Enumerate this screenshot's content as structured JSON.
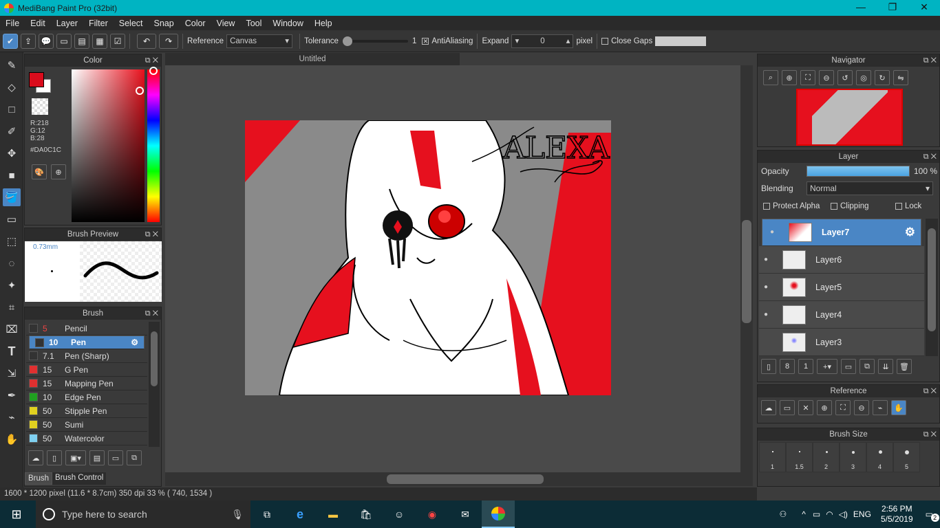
{
  "window": {
    "title": "MediBang Paint Pro (32bit)",
    "minimize": "—",
    "maximize": "❐",
    "close": "✕"
  },
  "menu": [
    "File",
    "Edit",
    "Layer",
    "Filter",
    "Select",
    "Snap",
    "Color",
    "View",
    "Tool",
    "Window",
    "Help"
  ],
  "toolbar": {
    "reference_label": "Reference",
    "reference_value": "Canvas",
    "tolerance_label": "Tolerance",
    "tolerance_value": "1",
    "antialiasing_label": "AntiAliasing",
    "expand_label": "Expand",
    "expand_value": "0",
    "expand_unit": "pixel",
    "closegaps_label": "Close Gaps"
  },
  "color_panel": {
    "title": "Color",
    "r": "R:218",
    "g": "G:12",
    "b": "B:28",
    "hex": "#DA0C1C",
    "fg_color": "#DA0C1C",
    "bg_color": "#FFFFFF"
  },
  "brush_preview": {
    "title": "Brush Preview",
    "size": "0.73mm"
  },
  "brush_panel": {
    "title": "Brush",
    "items": [
      {
        "size": "5",
        "name": "Pencil",
        "color": "#333333"
      },
      {
        "size": "10",
        "name": "Pen",
        "color": "#333333"
      },
      {
        "size": "7.1",
        "name": "Pen (Sharp)",
        "color": "#333333"
      },
      {
        "size": "15",
        "name": "G Pen",
        "color": "#e03030"
      },
      {
        "size": "15",
        "name": "Mapping Pen",
        "color": "#e03030"
      },
      {
        "size": "10",
        "name": "Edge Pen",
        "color": "#20a020"
      },
      {
        "size": "50",
        "name": "Stipple Pen",
        "color": "#e0d020"
      },
      {
        "size": "50",
        "name": "Sumi",
        "color": "#e0d020"
      },
      {
        "size": "50",
        "name": "Watercolor",
        "color": "#7fd0f0"
      }
    ],
    "selected_index": 1,
    "tab_brush": "Brush",
    "tab_control": "Brush Control"
  },
  "document": {
    "tab_title": "Untitled",
    "signature": "ALEXA"
  },
  "navigator": {
    "title": "Navigator"
  },
  "layer_panel": {
    "title": "Layer",
    "opacity_label": "Opacity",
    "opacity_value": "100 %",
    "opacity_fraction": 1.0,
    "blending_label": "Blending",
    "blending_value": "Normal",
    "protect_alpha": "Protect Alpha",
    "clipping": "Clipping",
    "lock": "Lock",
    "layers": [
      "Layer7",
      "Layer6",
      "Layer5",
      "Layer4",
      "Layer3"
    ],
    "selected_index": 0
  },
  "reference_panel": {
    "title": "Reference"
  },
  "brush_size_panel": {
    "title": "Brush Size",
    "sizes": [
      "1",
      "1.5",
      "2",
      "3",
      "4",
      "5"
    ]
  },
  "status": "1600 * 1200 pixel   (11.6 * 8.7cm)   350 dpi   33 %   ( 740, 1534 )",
  "taskbar": {
    "search_placeholder": "Type here to search",
    "lang": "ENG",
    "time": "2:56 PM",
    "date": "5/5/2019",
    "notifications": "2"
  }
}
